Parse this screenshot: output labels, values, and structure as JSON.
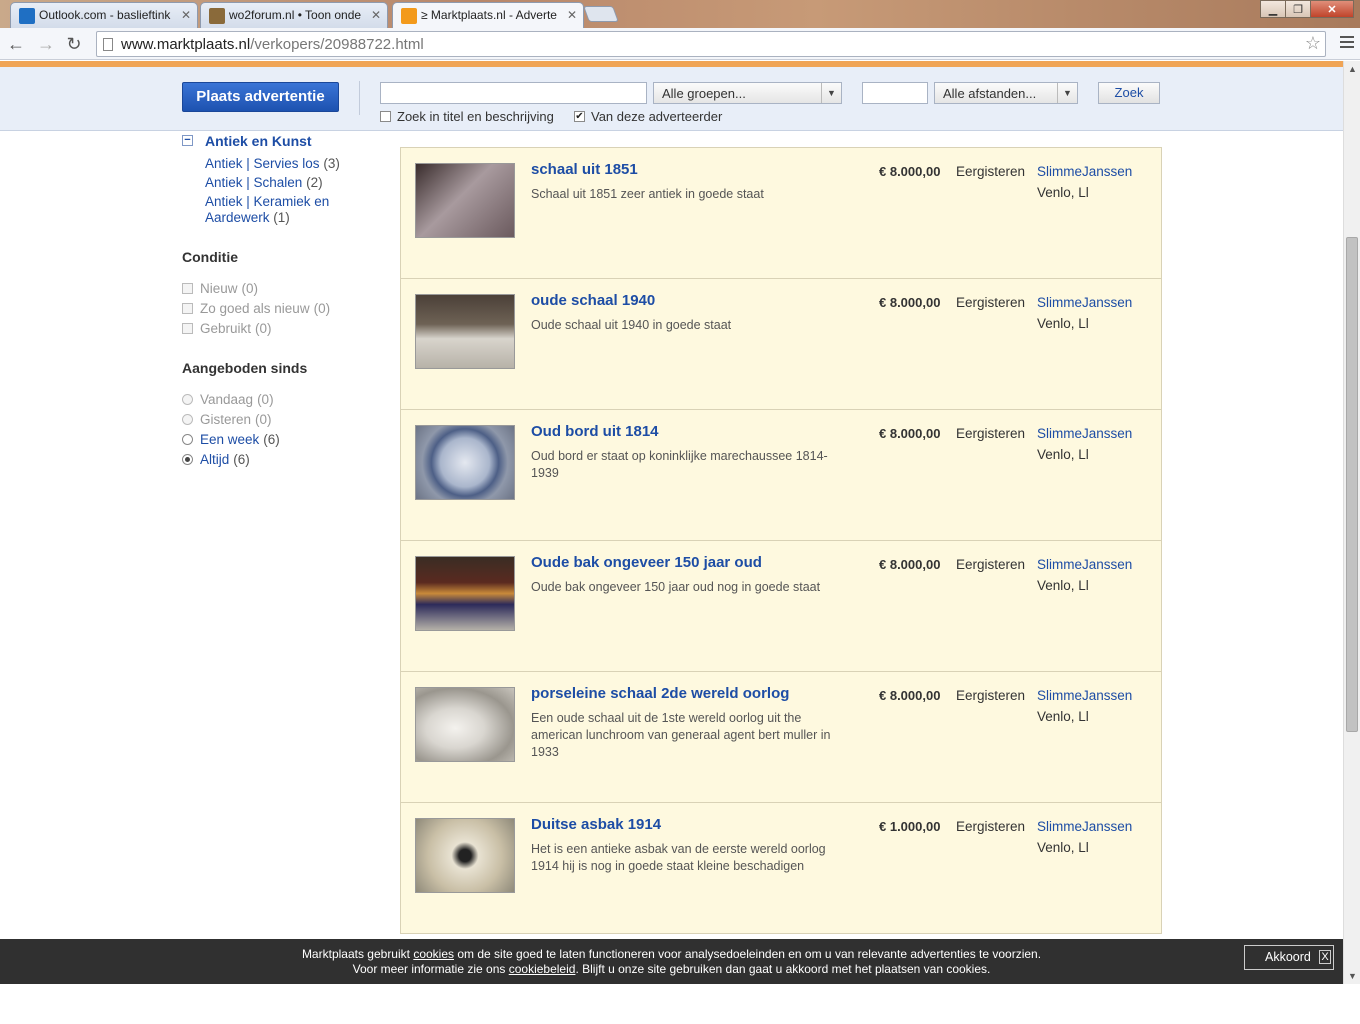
{
  "browser": {
    "tabs": [
      {
        "label": "Outlook.com - baslieftink",
        "favicon_color": "#1f6fc3"
      },
      {
        "label": "wo2forum.nl • Toon onde",
        "favicon_color": "#8a6a3a"
      },
      {
        "label": "≥ Marktplaats.nl - Adverte",
        "favicon_color": "#f39a1b"
      }
    ],
    "url_host": "www.marktplaats.nl",
    "url_path": "/verkopers/20988722.html"
  },
  "search": {
    "place_button": "Plaats advertentie",
    "groups_select": "Alle groepen...",
    "distance_select": "Alle afstanden...",
    "zoek_button": "Zoek",
    "check_title_desc": "Zoek in titel en beschrijving",
    "check_this_advertiser": "Van deze adverteerder"
  },
  "sidebar": {
    "category": "Antiek en Kunst",
    "subcats": [
      {
        "label": "Antiek | Servies los",
        "count": "(3)"
      },
      {
        "label": "Antiek | Schalen",
        "count": "(2)"
      },
      {
        "label": "Antiek | Keramiek en Aardewerk",
        "count": "(1)"
      }
    ],
    "conditie_title": "Conditie",
    "conditie": [
      {
        "label": "Nieuw",
        "count": "(0)"
      },
      {
        "label": "Zo goed als nieuw",
        "count": "(0)"
      },
      {
        "label": "Gebruikt",
        "count": "(0)"
      }
    ],
    "since_title": "Aangeboden sinds",
    "since": [
      {
        "label": "Vandaag",
        "count": "(0)"
      },
      {
        "label": "Gisteren",
        "count": "(0)"
      },
      {
        "label": "Een week",
        "count": "(6)"
      },
      {
        "label": "Altijd",
        "count": "(6)"
      }
    ]
  },
  "listings": [
    {
      "title": "schaal uit 1851",
      "desc": "Schaal uit 1851 zeer antiek in goede staat",
      "price": "€ 8.000,00",
      "date": "Eergisteren",
      "seller": "SlimmeJanssen",
      "location": "Venlo, Ll",
      "thumb_color": "#5b4a4a"
    },
    {
      "title": "oude schaal 1940",
      "desc": "Oude schaal uit 1940 in goede staat",
      "price": "€ 8.000,00",
      "date": "Eergisteren",
      "seller": "SlimmeJanssen",
      "location": "Venlo, Ll",
      "thumb_color": "#6b6258"
    },
    {
      "title": "Oud bord uit 1814",
      "desc": "Oud bord er staat op koninklijke marechaussee 1814-1939",
      "price": "€ 8.000,00",
      "date": "Eergisteren",
      "seller": "SlimmeJanssen",
      "location": "Venlo, Ll",
      "thumb_color": "#7c8aa6"
    },
    {
      "title": "Oude bak ongeveer 150 jaar oud",
      "desc": "Oude bak ongeveer 150 jaar oud nog in goede staat",
      "price": "€ 8.000,00",
      "date": "Eergisteren",
      "seller": "SlimmeJanssen",
      "location": "Venlo, Ll",
      "thumb_color": "#4a3b2e"
    },
    {
      "title": "porseleine schaal 2de wereld oorlog",
      "desc": "Een oude schaal uit de 1ste wereld oorlog uit the american lunchroom van generaal agent bert muller in 1933",
      "price": "€ 8.000,00",
      "date": "Eergisteren",
      "seller": "SlimmeJanssen",
      "location": "Venlo, Ll",
      "thumb_color": "#b9b6b0"
    },
    {
      "title": "Duitse asbak 1914",
      "desc": "Het is een antieke asbak van de eerste wereld oorlog 1914 hij is nog in goede staat kleine beschadigen",
      "price": "€ 1.000,00",
      "date": "Eergisteren",
      "seller": "SlimmeJanssen",
      "location": "Venlo, Ll",
      "thumb_color": "#d8d2c2"
    }
  ],
  "cookie": {
    "line1_a": "Marktplaats gebruikt ",
    "line1_link": "cookies",
    "line1_b": " om de site goed te laten functioneren voor analysedoeleinden en om u van relevante advertenties te voorzien.",
    "line2_a": "Voor meer informatie zie ons ",
    "line2_link": "cookiebeleid",
    "line2_b": ". Blijft u onze site gebruiken dan gaat u akkoord met het plaatsen van cookies.",
    "accept": "Akkoord",
    "close": "X"
  }
}
